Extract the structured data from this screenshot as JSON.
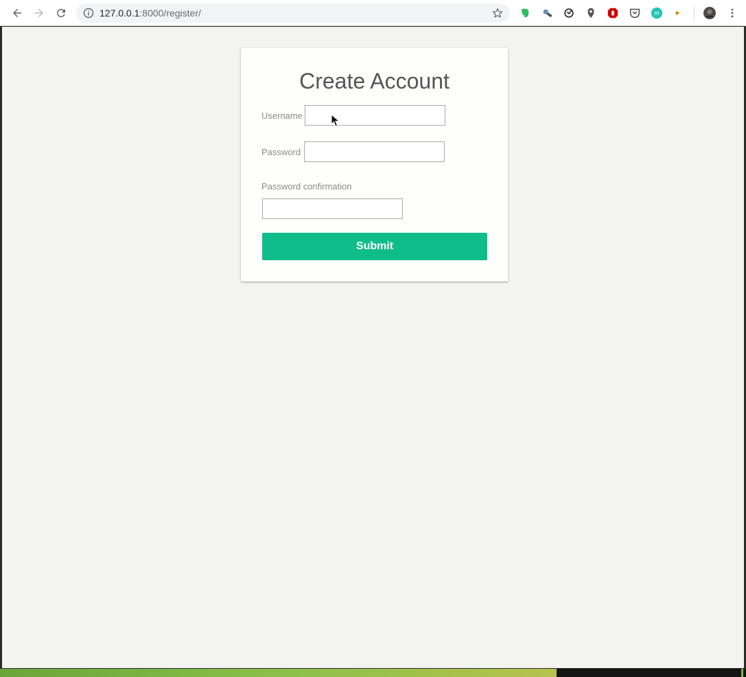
{
  "browser": {
    "url_host": "127.0.0.1",
    "url_rest": ":8000/register/",
    "extensions": [
      "evernote-icon",
      "satellite-icon",
      "sync-icon",
      "pin-icon",
      "stop-hand-icon",
      "pocket-icon",
      "m-badge-icon",
      "tag-icon",
      "profile-avatar"
    ],
    "m_badge_text": "m"
  },
  "form": {
    "title": "Create Account",
    "username_label": "Username",
    "password_label": "Password",
    "password_confirmation_label": "Password confirmation",
    "username_value": "",
    "password_value": "",
    "password_confirmation_value": "",
    "submit_label": "Submit"
  },
  "colors": {
    "accent": "#0fbd8a",
    "page_background": "#f3f3f0",
    "card_background": "#fefefc",
    "title_text": "#555555",
    "label_text": "#8a8a8a"
  }
}
